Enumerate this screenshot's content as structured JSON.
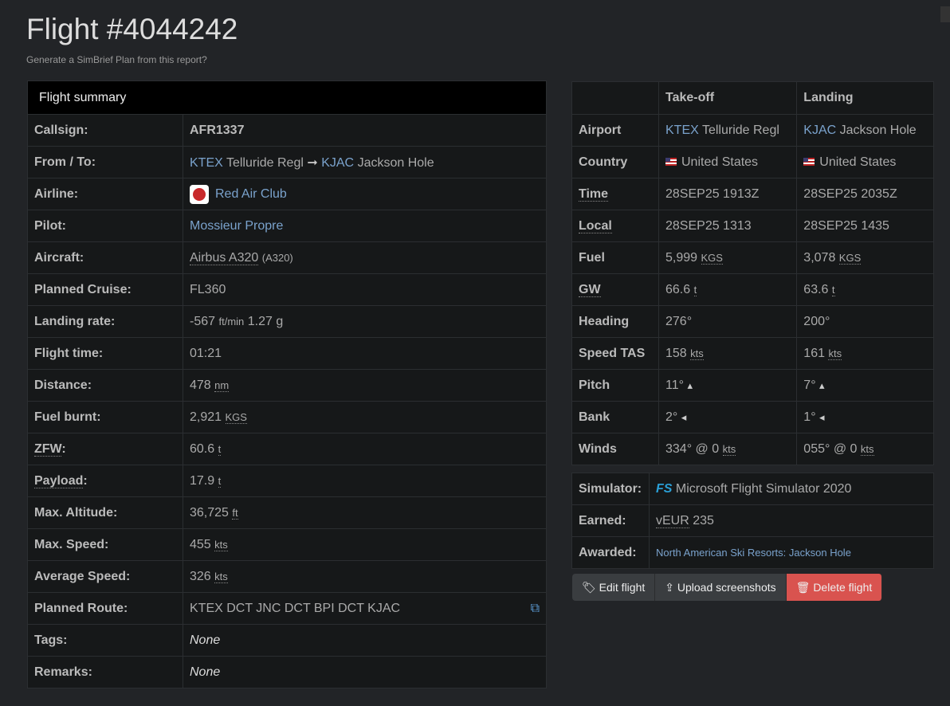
{
  "title": "Flight #4044242",
  "subtitle": "Generate a SimBrief Plan from this report?",
  "summary": {
    "heading": "Flight summary",
    "callsign_label": "Callsign:",
    "callsign": "AFR1337",
    "fromto_label": "From / To:",
    "from_code": "KTEX",
    "from_name": "Telluride Regl",
    "arrow": "➞",
    "to_code": "KJAC",
    "to_name": "Jackson Hole",
    "airline_label": "Airline:",
    "airline": "Red Air Club",
    "pilot_label": "Pilot:",
    "pilot": "Mossieur Propre",
    "aircraft_label": "Aircraft:",
    "aircraft": "Airbus A320",
    "aircraft_code": "(A320)",
    "cruise_label": "Planned Cruise:",
    "cruise": "FL360",
    "landing_label": "Landing rate:",
    "landing_rate": "-567",
    "landing_unit": "ft/min",
    "landing_g": "1.27 g",
    "time_label": "Flight time:",
    "time": "01:21",
    "distance_label": "Distance:",
    "distance": "478",
    "distance_unit": "nm",
    "fuel_label": "Fuel burnt:",
    "fuel": "2,921",
    "fuel_unit": "KGS",
    "zfw_label": "ZFW",
    "zfw": "60.6",
    "zfw_unit": "t",
    "payload_label": "Payload",
    "payload": "17.9",
    "payload_unit": "t",
    "maxalt_label": "Max. Altitude:",
    "maxalt": "36,725",
    "maxalt_unit": "ft",
    "maxspd_label": "Max. Speed:",
    "maxspd": "455",
    "spd_unit": "kts",
    "avgspd_label": "Average Speed:",
    "avgspd": "326",
    "route_label": "Planned Route:",
    "route": "KTEX DCT JNC DCT BPI DCT KJAC",
    "tags_label": "Tags:",
    "tags": "None",
    "remarks_label": "Remarks:",
    "remarks": "None"
  },
  "phases": {
    "takeoff": "Take-off",
    "landing": "Landing",
    "airport_label": "Airport",
    "to_code": "KTEX",
    "to_name": "Telluride Regl",
    "ld_code": "KJAC",
    "ld_name": "Jackson Hole",
    "country_label": "Country",
    "to_country": "United States",
    "ld_country": "United States",
    "time_label": "Time",
    "to_time": "28SEP25 1913Z",
    "ld_time": "28SEP25 2035Z",
    "local_label": "Local",
    "to_local": "28SEP25 1313",
    "ld_local": "28SEP25 1435",
    "fuel_label": "Fuel",
    "to_fuel": "5,999",
    "ld_fuel": "3,078",
    "fuel_unit": "KGS",
    "gw_label": "GW",
    "to_gw": "66.6",
    "ld_gw": "63.6",
    "gw_unit": "t",
    "heading_label": "Heading",
    "to_heading": "276°",
    "ld_heading": "200°",
    "speed_label": "Speed TAS",
    "to_speed": "158",
    "ld_speed": "161",
    "kts": "kts",
    "pitch_label": "Pitch",
    "to_pitch": "11°",
    "ld_pitch": "7°",
    "bank_label": "Bank",
    "to_bank": "2°",
    "ld_bank": "1°",
    "winds_label": "Winds",
    "to_winds": "334° @ 0",
    "ld_winds": "055° @ 0"
  },
  "info": {
    "sim_label": "Simulator:",
    "sim": "Microsoft Flight Simulator 2020",
    "earned_label": "Earned:",
    "currency": "vEUR",
    "earned": "235",
    "awarded_label": "Awarded:",
    "awarded": "North American Ski Resorts: Jackson Hole"
  },
  "buttons": {
    "edit": "Edit flight",
    "upload": "Upload screenshots",
    "delete": "Delete flight"
  }
}
